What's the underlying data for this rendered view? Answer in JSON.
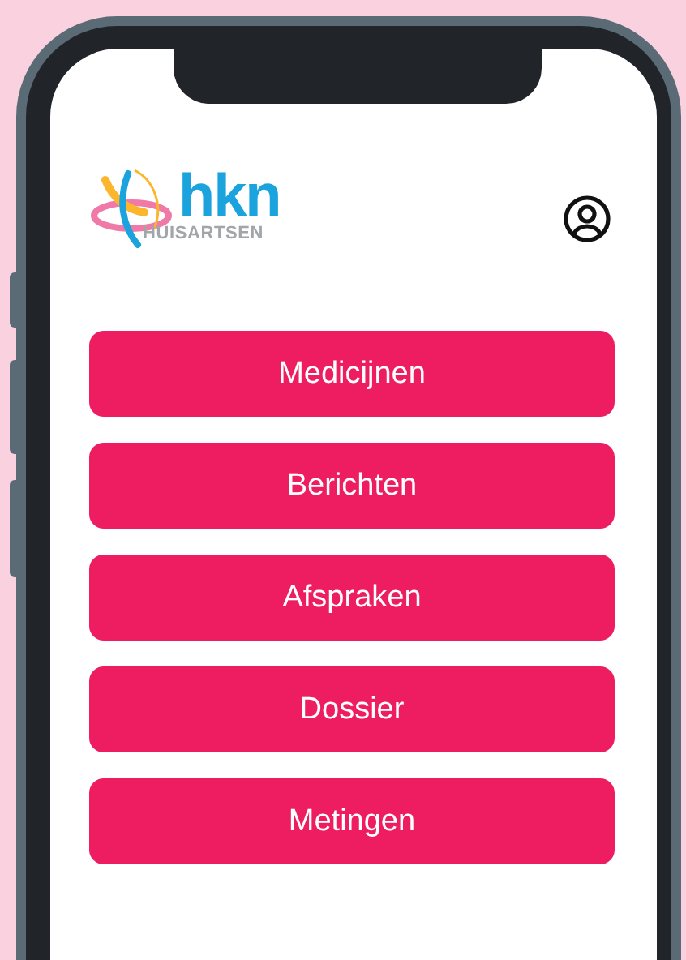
{
  "logo": {
    "name": "hkn",
    "subtitle": "HUISARTSEN"
  },
  "menu": [
    {
      "label": "Medicijnen"
    },
    {
      "label": "Berichten"
    },
    {
      "label": "Afspraken"
    },
    {
      "label": "Dossier"
    },
    {
      "label": "Metingen"
    }
  ]
}
